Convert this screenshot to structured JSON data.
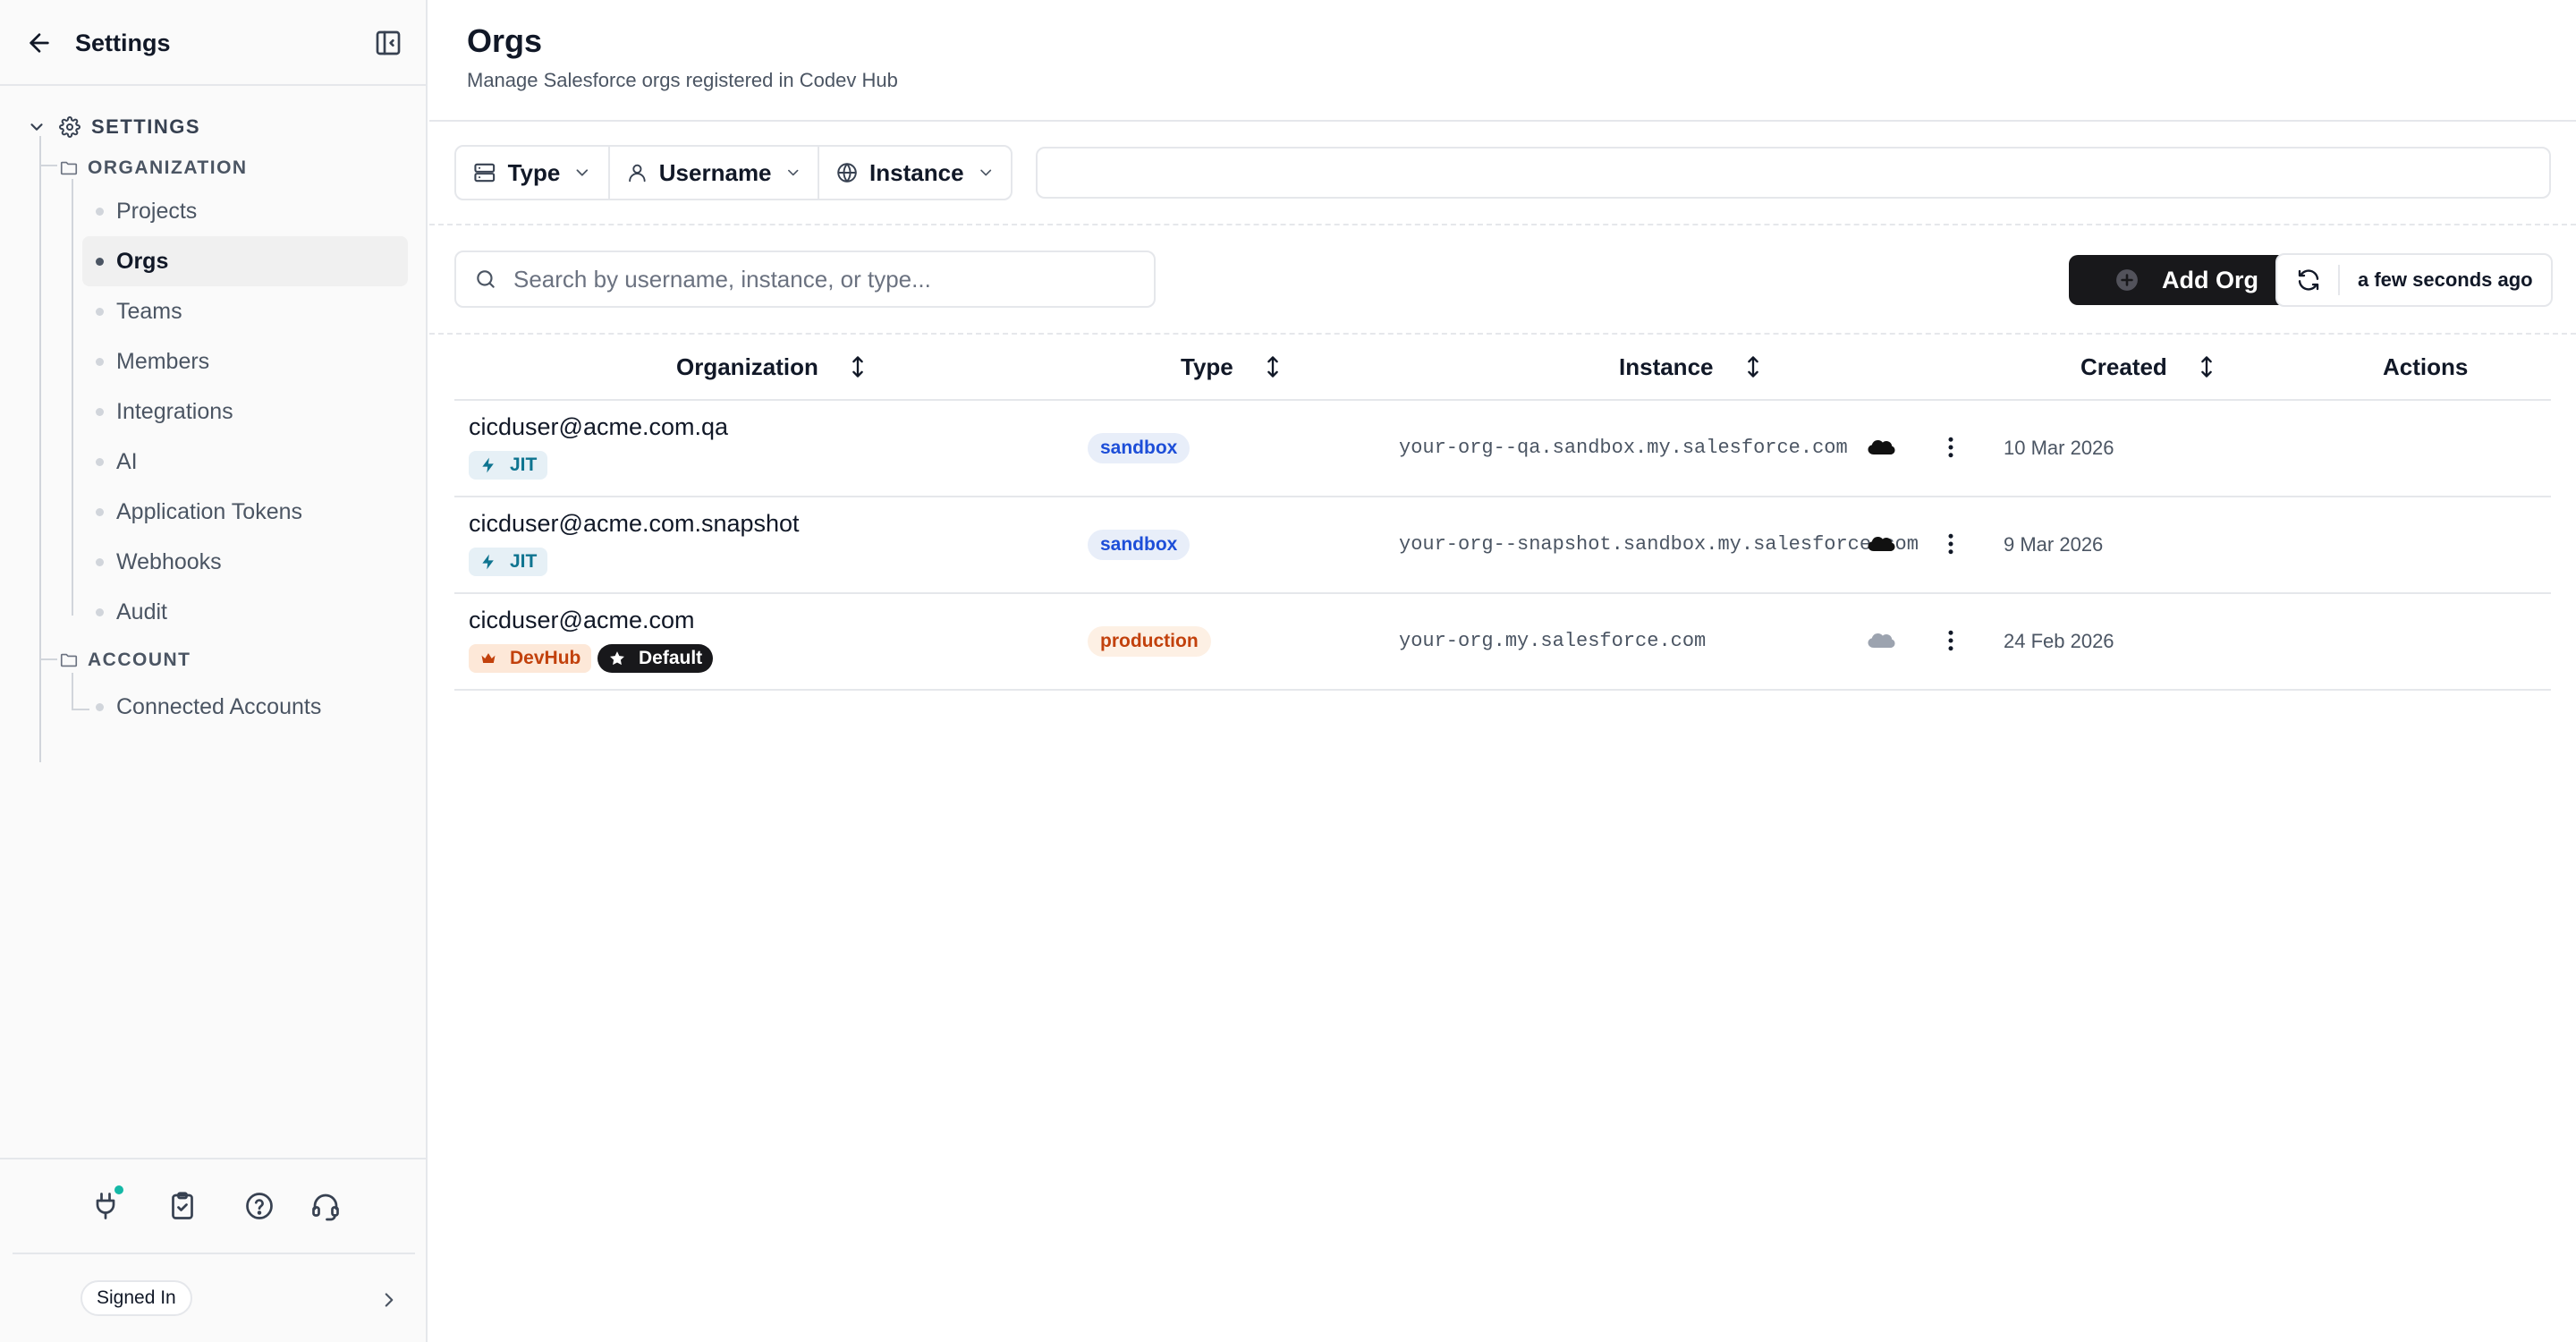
{
  "sidebar": {
    "title": "Settings",
    "section_label": "SETTINGS",
    "groups": {
      "organization": "ORGANIZATION",
      "account": "ACCOUNT"
    },
    "items": [
      {
        "label": "Projects"
      },
      {
        "label": "Orgs",
        "active": true
      },
      {
        "label": "Teams"
      },
      {
        "label": "Members"
      },
      {
        "label": "Integrations"
      },
      {
        "label": "AI"
      },
      {
        "label": "Application Tokens"
      },
      {
        "label": "Webhooks"
      },
      {
        "label": "Audit"
      },
      {
        "label": "Connected Accounts"
      }
    ],
    "footer": {
      "signed_in_label": "Signed In"
    }
  },
  "header": {
    "title": "Orgs",
    "subtitle": "Manage Salesforce orgs registered in Codev Hub"
  },
  "filters": {
    "type_label": "Type",
    "username_label": "Username",
    "instance_label": "Instance"
  },
  "toolbar": {
    "search_placeholder": "Search by username, instance, or type...",
    "add_label": "Add Org",
    "last_refreshed": "a few seconds ago"
  },
  "table": {
    "columns": {
      "organization": "Organization",
      "type": "Type",
      "instance": "Instance",
      "created": "Created",
      "actions": "Actions"
    },
    "rows": [
      {
        "username": "cicduser@acme.com.qa",
        "tags": [
          "JIT"
        ],
        "type": "sandbox",
        "instance": "your-org--qa.sandbox.my.salesforce.com",
        "created": "10 Mar 2026"
      },
      {
        "username": "cicduser@acme.com.snapshot",
        "tags": [
          "JIT"
        ],
        "type": "sandbox",
        "instance": "your-org--snapshot.sandbox.my.salesforce.com",
        "created": "9 Mar 2026"
      },
      {
        "username": "cicduser@acme.com",
        "tags": [
          "DevHub",
          "Default"
        ],
        "type": "production",
        "instance": "your-org.my.salesforce.com",
        "created": "24 Feb 2026"
      }
    ]
  },
  "colors": {
    "accent_dark": "#18181b",
    "jit": "#0e7490",
    "devhub": "#c2410c",
    "sandbox": "#1d4ed8",
    "notification": "#14b8a6"
  }
}
